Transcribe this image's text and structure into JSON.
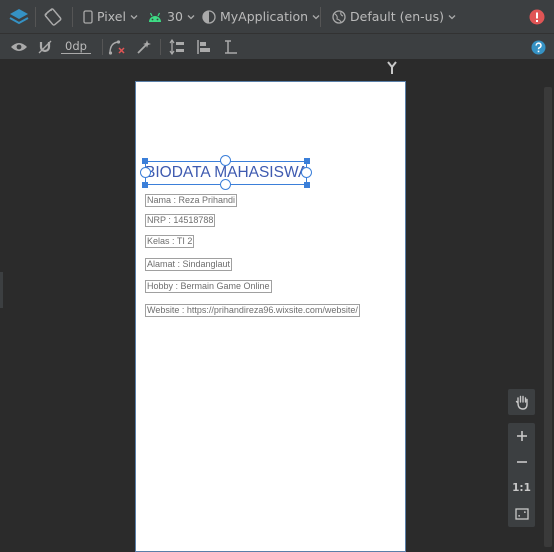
{
  "toolbar_top": {
    "device": "Pixel",
    "api_level": "30",
    "theme": "MyApplication",
    "locale": "Default (en-us)"
  },
  "toolbar_second": {
    "margin_value": "0dp"
  },
  "layout": {
    "title": "BIODATA MAHASISWA",
    "fields": [
      "Nama : Reza Prihandi",
      "NRP : 14518788",
      "Kelas : TI 2",
      "Alamat : Sindanglaut",
      "Hobby : Bermain Game Online",
      "Website : https://prihandireza96.wixsite.com/website/"
    ]
  },
  "zoom_controls": {
    "one_to_one": "1:1"
  },
  "colors": {
    "toolbar_bg": "#3c3f41",
    "canvas_bg": "#2b2b2b",
    "selection_blue": "#3b7fd9",
    "title_text": "#3e5ab0",
    "error_red": "#e05555",
    "help_blue": "#3592c4"
  }
}
